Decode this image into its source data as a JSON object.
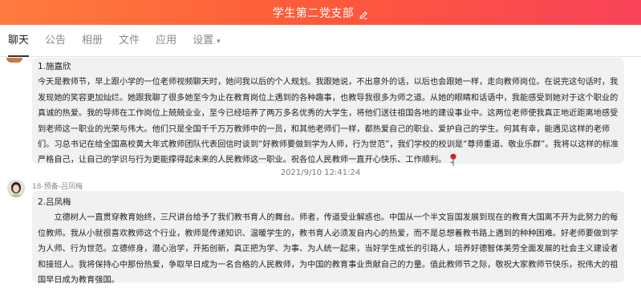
{
  "window": {
    "title": "学生第二党支部"
  },
  "tabs": [
    {
      "label": "聊天",
      "active": true
    },
    {
      "label": "公告",
      "active": false
    },
    {
      "label": "相册",
      "active": false
    },
    {
      "label": "文件",
      "active": false
    },
    {
      "label": "应用",
      "active": false
    },
    {
      "label": "设置",
      "active": false
    }
  ],
  "messages": [
    {
      "title": "1.施嘉欣",
      "body": "今天是教师节，早上跟小学的一位老师视频聊天时，她问我以后的个人规划。我跟她说，不出意外的话，以后也会跟她一样，走向教师岗位。在说完这句话时，我发现她的笑容更加灿烂。她跟我聊了很多她至今为止在教育岗位上遇到的各种趣事，也教导我很多为师之道。从她的眼睛和话语中，我能感受到她对于这个职业的真诚的热爱。我的导师在工作岗位上兢兢业业，至今已经培养了两万多名优秀的大学生，将他们送往祖国各地的建设事业中。这两位老师使我真正地近距离地感受到老师这一职业的光荣与伟大。他们只是全国千千万万教师中的一员，和其他老师们一样，都热爱自己的职业、爱护自己的学生。何其有幸，能遇见这样的老师们。习总书记在给全国高校黄大年式教师团队代表回信时谈到“好教师要做到学为人师，行为世范”，我们学校的校训是“尊师重道、敬业乐群”。我将以这样的标准严格自己，让自己的学识与行为更能撑得起未来的人民教师这一职业。祝各位人民教师一直开心快乐、工作顺利。"
    },
    {
      "sender": "18-预备-吕凤梅",
      "title": "2.吕凤梅",
      "body": "立德树人一直贯穿教育始终，三尺讲台给予了我们教书育人的舞台。师者，传道受业解惑也。中国从一个半文盲国发展到现在的教育大国离不开为此努力的每位教师。我从小就很喜欢教师这个行业，教师是传递知识、温暖学生的，教书育人必须发自内心的热爱，而不是总想着教书路上遇到的种种困难。好老师要做到学为人师、行为世范。立德修身，潜心治学，开拓创新，真正把为学、为事、为人统一起来，当好学生成长的引路人，培养好德智体美劳全面发展的社会主义建设者和接班人。我将保持心中那份热爱，争取早日成为一名合格的人民教师，为中国的教育事业贡献自己的力量。值此教师节之际，敬祝大家教师节快乐，祝伟大的祖国早日成为教育强国。"
    }
  ],
  "timestamp": "2021/9/10 12:41:24",
  "icons": {
    "edit": "pencil-icon",
    "settings_caret": "chevron-down-icon",
    "rose": "rose-icon"
  },
  "colors": {
    "header_start": "#ff7c3e",
    "header_end": "#f9435a",
    "bubble_bg": "#f1f1f1"
  }
}
